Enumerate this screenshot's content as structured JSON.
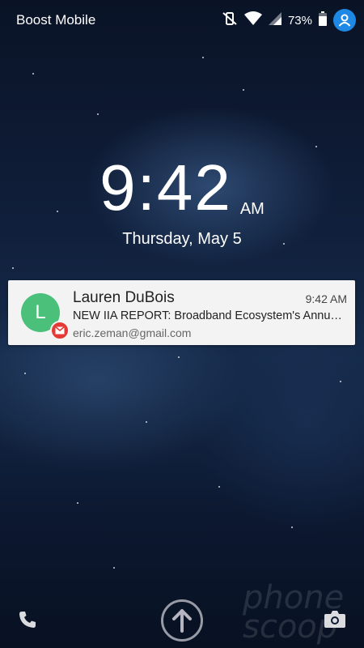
{
  "status_bar": {
    "carrier": "Boost Mobile",
    "battery_percent": "73%",
    "icons": [
      "vibrate-off-icon",
      "wifi-icon",
      "cell-signal-icon",
      "battery-icon",
      "account-icon"
    ],
    "account_color": "#1e88e5"
  },
  "clock": {
    "time": "9:42",
    "ampm": "AM",
    "date": "Thursday, May 5"
  },
  "notification": {
    "avatar_letter": "L",
    "avatar_color": "#4ac07a",
    "badge_icon": "gmail-icon",
    "badge_color": "#e53935",
    "sender": "Lauren DuBois",
    "time": "9:42 AM",
    "subject": "NEW IIA REPORT: Broadband Ecosystem's Annual I...",
    "account": "eric.zeman@gmail.com"
  },
  "bottom_bar": {
    "left_icon": "phone-icon",
    "center_icon": "unlock-arrow-icon",
    "right_icon": "camera-icon"
  },
  "watermark": {
    "line1": "phone",
    "line2": "scoop"
  }
}
